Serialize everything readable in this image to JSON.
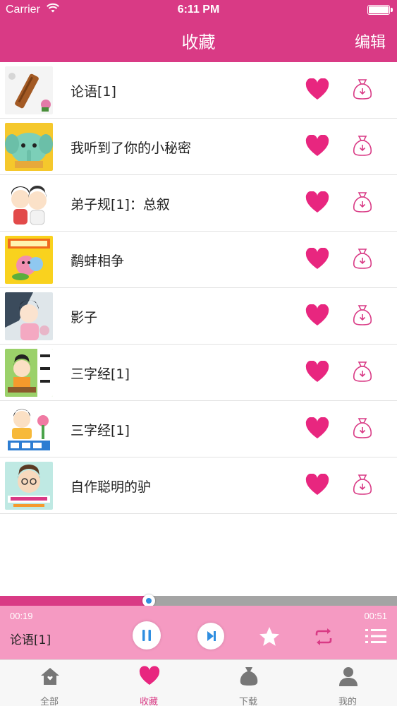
{
  "status_bar": {
    "carrier": "Carrier",
    "time": "6:11 PM"
  },
  "nav": {
    "title": "收藏",
    "edit_label": "编辑"
  },
  "colors": {
    "brand": "#d93a85",
    "player_bg": "#f59ac2",
    "heart": "#e8267f",
    "download": "#d93a85",
    "knob_dot": "#2f8ee0"
  },
  "items": [
    {
      "title": "论语[1]",
      "thumb": "book-scroll"
    },
    {
      "title": "我听到了你的小秘密",
      "thumb": "elephant"
    },
    {
      "title": "弟子规[1]：总叙",
      "thumb": "kids"
    },
    {
      "title": "鹬蚌相争",
      "thumb": "bedtime-story"
    },
    {
      "title": "影子",
      "thumb": "girl-reading"
    },
    {
      "title": "三字经[1]",
      "thumb": "sanzijing"
    },
    {
      "title": "三字经[1]",
      "thumb": "sanzijing-2"
    },
    {
      "title": "自作聪明的驴",
      "thumb": "storyteller"
    }
  ],
  "player": {
    "elapsed": "00:19",
    "total": "00:51",
    "progress": 0.375,
    "now_playing": "论语[1]"
  },
  "tabs": [
    {
      "label": "全部",
      "icon": "home-icon",
      "active": false
    },
    {
      "label": "收藏",
      "icon": "heart-icon",
      "active": true
    },
    {
      "label": "下载",
      "icon": "bag-icon",
      "active": false
    },
    {
      "label": "我的",
      "icon": "person-icon",
      "active": false
    }
  ]
}
